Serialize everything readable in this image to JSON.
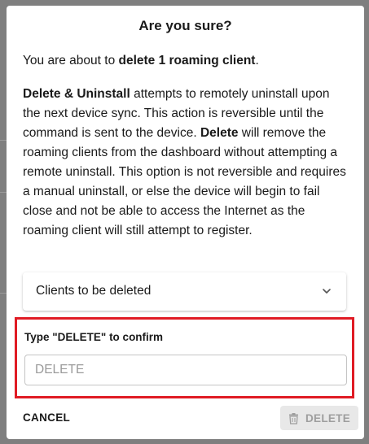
{
  "dialog": {
    "title": "Are you sure?",
    "intro_prefix": "You are about to ",
    "intro_bold": "delete 1 roaming client",
    "intro_suffix": ".",
    "desc_bold1": "Delete & Uninstall",
    "desc_text1": " attempts to remotely uninstall upon the next device sync. This action is reversible until the command is sent to the device. ",
    "desc_bold2": "Delete",
    "desc_text2": " will remove the roaming clients from the dashboard without attempting a remote uninstall. This option is not reversible and requires a manual uninstall, or else the device will begin to fail close and not be able to access the Internet as the roaming client will still attempt to register.",
    "accordion_label": "Clients to be deleted",
    "confirm_label": "Type \"DELETE\" to confirm",
    "confirm_placeholder": "DELETE",
    "confirm_value": "",
    "cancel_label": "CANCEL",
    "delete_label": "DELETE"
  },
  "icons": {
    "accordion": "chevron-down-icon",
    "delete": "trash-icon"
  },
  "colors": {
    "highlight": "#e01b24",
    "disabled_button_bg": "#e8e8e8",
    "disabled_button_text": "#9e9e9e"
  }
}
